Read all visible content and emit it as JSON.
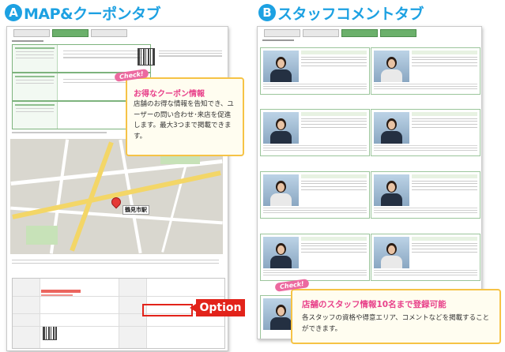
{
  "section_a": {
    "badge": "A",
    "title": "MAP&クーポンタブ",
    "tabs": [
      "",
      "",
      ""
    ],
    "coupon_heading": "お得なクーポン情報",
    "access_heading": "アクセスマップ",
    "station": "鶴見市駅",
    "callout": {
      "check": "Check!",
      "title": "お得なクーポン情報",
      "body": "店舗のお得な情報を告知でき、ユーザーの問い合わせ･来店を促進します。最大3つまで掲載できます。"
    },
    "option_label": "Option"
  },
  "section_b": {
    "badge": "B",
    "title": "スタッフコメントタブ",
    "tabs": [
      "",
      "",
      "",
      ""
    ],
    "callout": {
      "check": "Check!",
      "title": "店舗のスタッフ情報10名まで登録可能",
      "body": "各スタッフの資格や得意エリア、コメントなどを掲載することができます。"
    }
  }
}
